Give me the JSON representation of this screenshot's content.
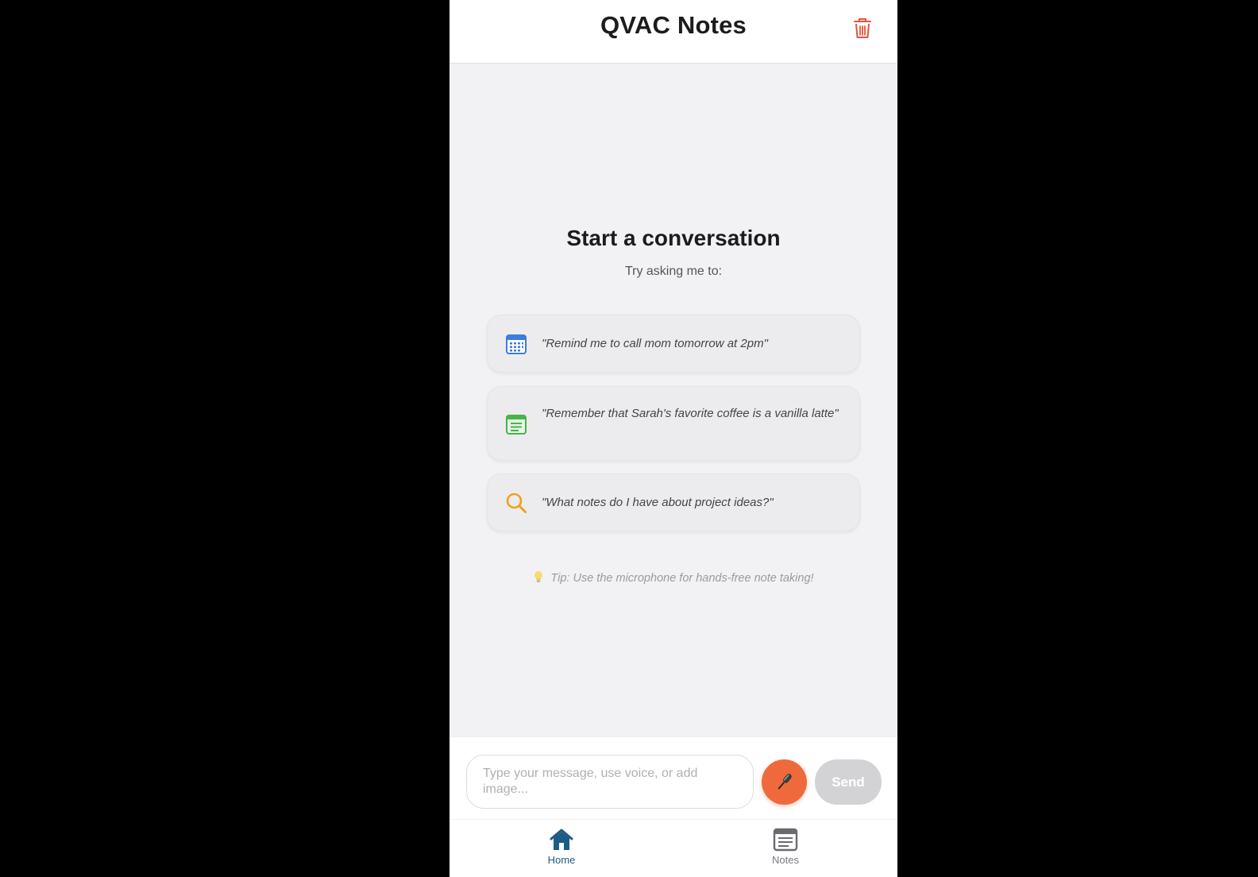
{
  "header": {
    "title": "QVAC Notes",
    "trash_icon": "trash-icon",
    "trash_color": "#e5533d"
  },
  "empty_state": {
    "title": "Start a conversation",
    "subtitle": "Try asking me to:",
    "suggestions": [
      {
        "icon": "calendar-icon",
        "text": "\"Remind me to call mom tomorrow at 2pm\""
      },
      {
        "icon": "note-icon",
        "text": "\"Remember that Sarah's favorite coffee is a vanilla latte\""
      },
      {
        "icon": "search-icon",
        "text": "\"What notes do I have about project ideas?\""
      }
    ],
    "tip": "Tip: Use the microphone for hands-free note taking!",
    "tip_icon": "lightbulb-icon"
  },
  "composer": {
    "placeholder": "Type your message, use voice, or add image...",
    "mic_icon": "microphone-icon",
    "mic_color": "#ee6a3d",
    "send_label": "Send"
  },
  "tabs": [
    {
      "label": "Home",
      "icon": "home-icon",
      "active": true
    },
    {
      "label": "Notes",
      "icon": "notes-icon",
      "active": false
    }
  ],
  "colors": {
    "accent": "#1e5c86",
    "background": "#f2f2f4"
  }
}
